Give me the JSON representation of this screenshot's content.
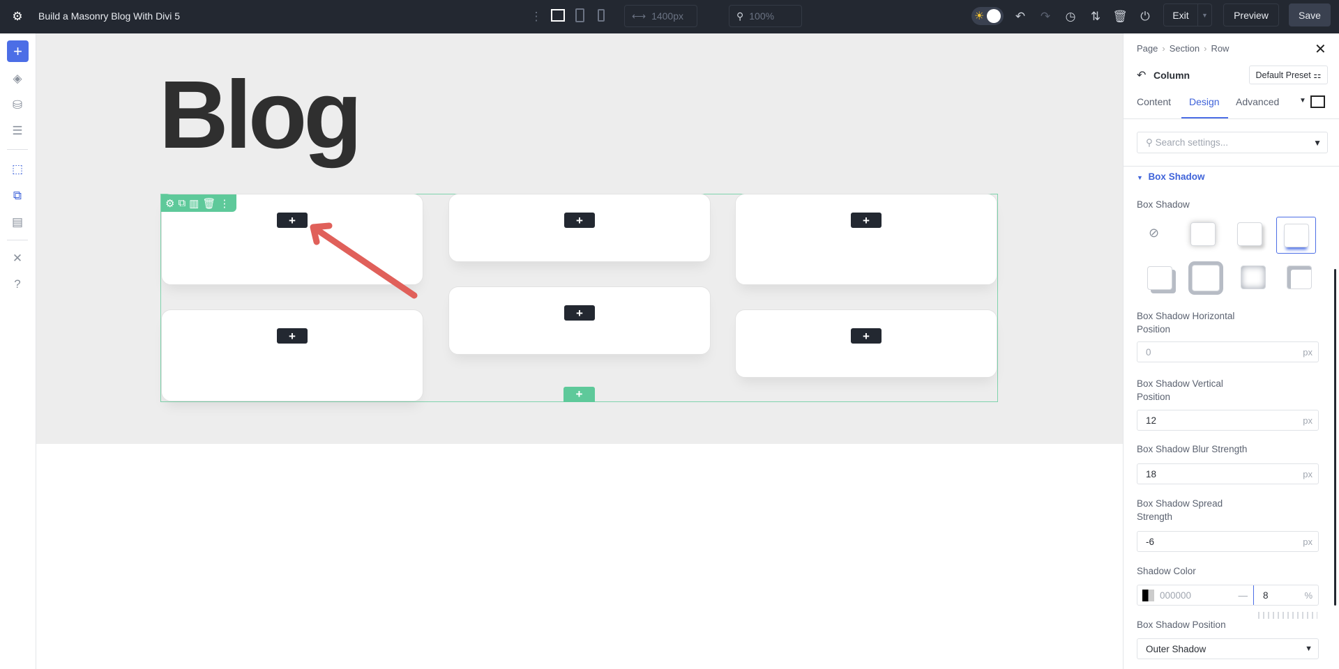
{
  "topbar": {
    "title": "Build a Masonry Blog With Divi 5",
    "width_value": "1400px",
    "zoom_value": "100%",
    "exit_label": "Exit",
    "preview_label": "Preview",
    "save_label": "Save"
  },
  "canvas": {
    "heading": "Blog",
    "add_module_label": "+",
    "add_row_label": "+"
  },
  "panel": {
    "breadcrumb": [
      "Page",
      "Section",
      "Row"
    ],
    "element": "Column",
    "preset": "Default Preset",
    "tabs": [
      "Content",
      "Design",
      "Advanced"
    ],
    "active_tab": "Design",
    "search_placeholder": "Search settings...",
    "group_title": "Box Shadow",
    "box_shadow_label": "Box Shadow",
    "fields": {
      "horizontal": {
        "label1": "Box Shadow Horizontal",
        "label2": "Position",
        "value": "0",
        "unit": "px"
      },
      "vertical": {
        "label1": "Box Shadow Vertical",
        "label2": "Position",
        "value": "12",
        "unit": "px"
      },
      "blur": {
        "label": "Box Shadow Blur Strength",
        "value": "18",
        "unit": "px"
      },
      "spread": {
        "label1": "Box Shadow Spread",
        "label2": "Strength",
        "value": "-6",
        "unit": "px"
      },
      "color": {
        "label": "Shadow Color",
        "hex": "000000",
        "opacity": "8",
        "unit": "%"
      },
      "position": {
        "label": "Box Shadow Position",
        "value": "Outer Shadow"
      }
    }
  },
  "colors": {
    "accent": "#4c6ee6",
    "row": "#5ec99a",
    "arrow": "#e0605a",
    "topbar": "#232831"
  }
}
